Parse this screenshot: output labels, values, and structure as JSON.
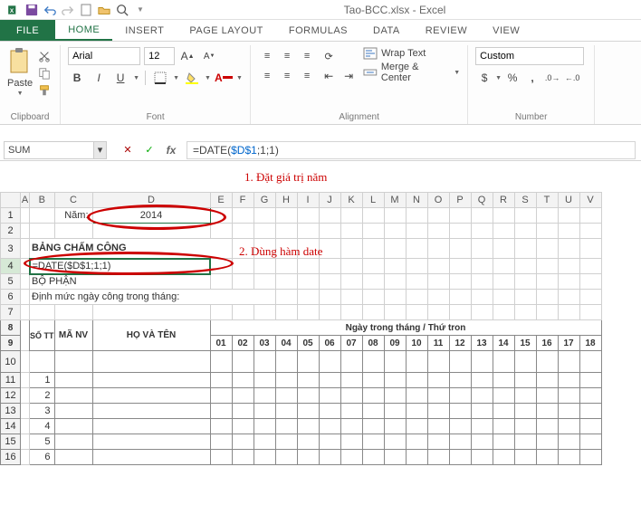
{
  "title": "Tao-BCC.xlsx - Excel",
  "tabs": {
    "file": "FILE",
    "home": "HOME",
    "insert": "INSERT",
    "page_layout": "PAGE LAYOUT",
    "formulas": "FORMULAS",
    "data": "DATA",
    "review": "REVIEW",
    "view": "VIEW"
  },
  "ribbon": {
    "clipboard": {
      "paste": "Paste",
      "label": "Clipboard"
    },
    "font": {
      "name": "Arial",
      "size": "12",
      "label": "Font"
    },
    "alignment": {
      "wrap": "Wrap Text",
      "merge": "Merge & Center",
      "label": "Alignment"
    },
    "number": {
      "format": "Custom",
      "label": "Number"
    }
  },
  "namebox": "SUM",
  "formula": {
    "prefix": "=DATE(",
    "ref": "$D$1",
    "suffix": ";1;1)"
  },
  "annotation1": "1. Đặt giá trị năm",
  "annotation2": "2. Dùng hàm date",
  "sheet": {
    "cols": [
      "A",
      "B",
      "C",
      "D",
      "E",
      "F",
      "G",
      "H",
      "I",
      "J",
      "K",
      "L",
      "M",
      "N",
      "O",
      "P",
      "Q",
      "R",
      "S",
      "T",
      "U",
      "V"
    ],
    "r1_c": "Năm:",
    "r1_d": "2014",
    "r3_title": "BẢNG CHẤM CÔNG",
    "r4_formula": "=DATE($D$1;1;1)",
    "r5": "BỘ PHẬN",
    "r6": "Định mức ngày công trong tháng:",
    "hdr_daymonth": "Ngày trong tháng / Thứ tron",
    "hdr_stt": "SỐ TT",
    "hdr_manv": "MÃ NV",
    "hdr_hoten": "HỌ VÀ TÊN",
    "days": [
      "01",
      "02",
      "03",
      "04",
      "05",
      "06",
      "07",
      "08",
      "09",
      "10",
      "11",
      "12",
      "13",
      "14",
      "15",
      "16",
      "17",
      "18"
    ],
    "row_nums": [
      "1",
      "2",
      "3",
      "4",
      "5",
      "6"
    ]
  }
}
